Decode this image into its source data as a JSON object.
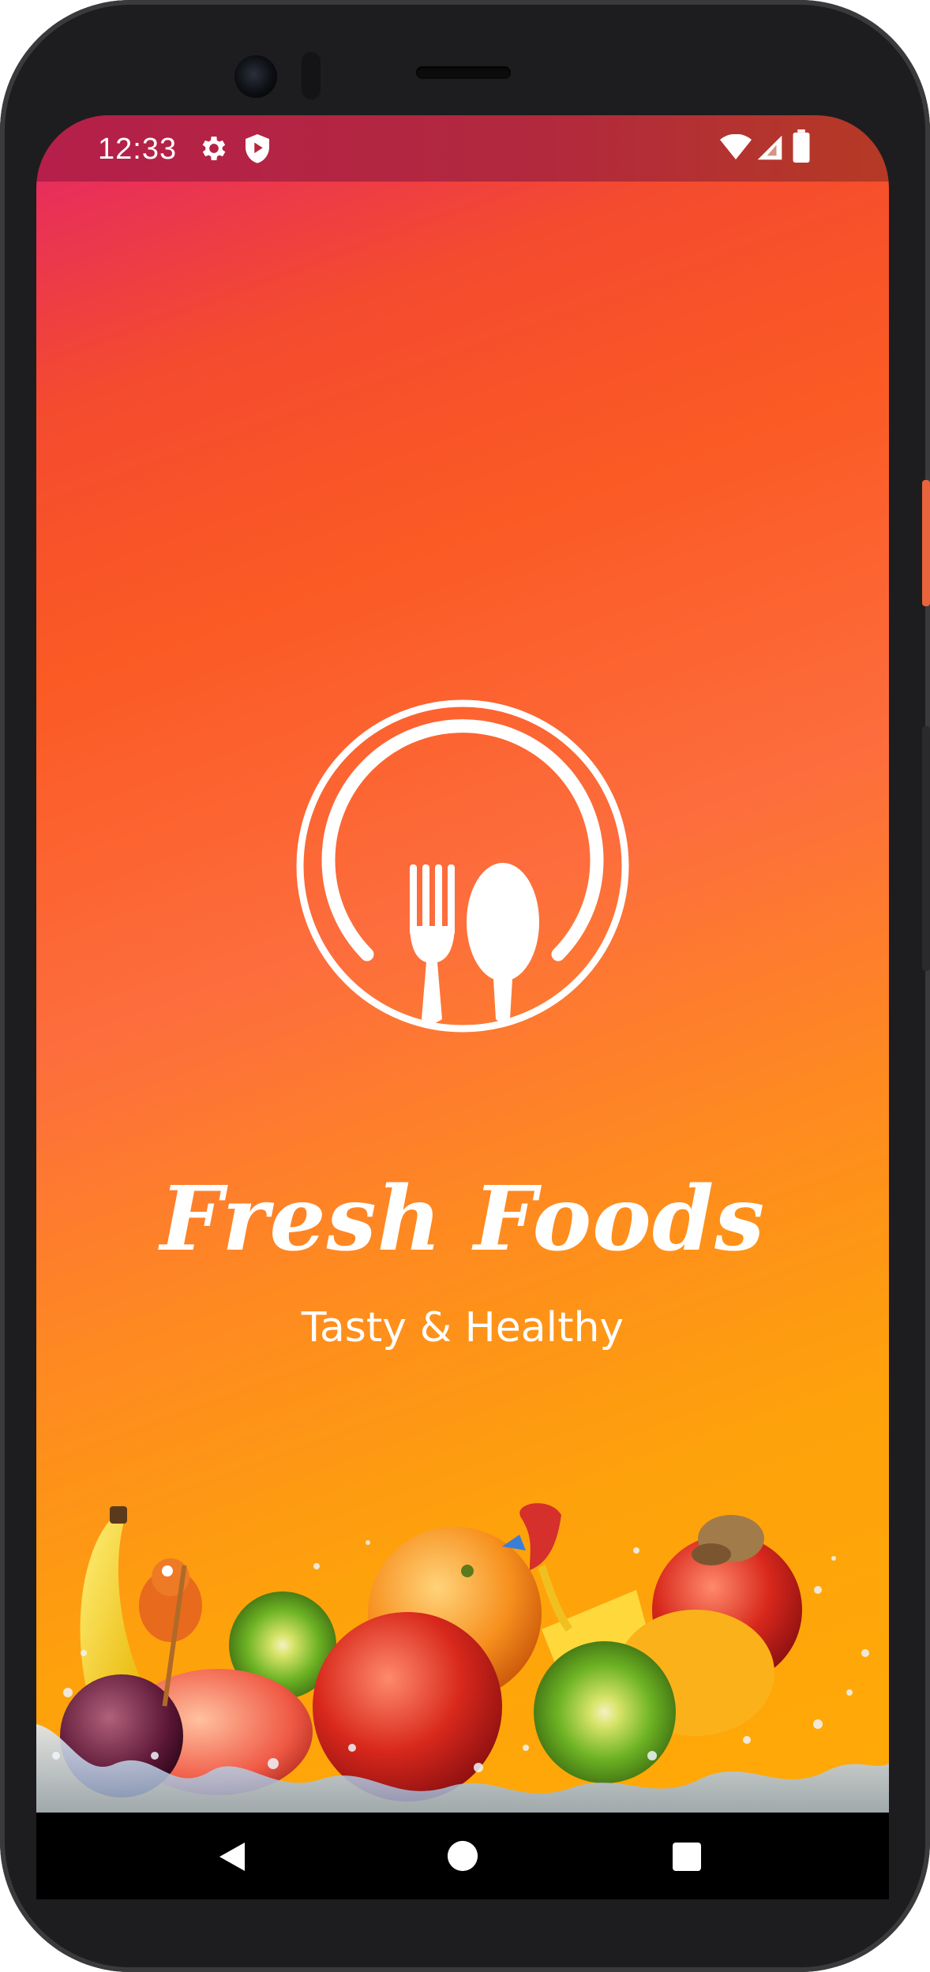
{
  "status_bar": {
    "time": "12:33",
    "left_icons": [
      "gear-icon",
      "shield-play-icon"
    ],
    "right_icons": [
      "wifi-icon",
      "signal-icon",
      "battery-icon"
    ]
  },
  "splash": {
    "title": "Fresh Foods",
    "subtitle": "Tasty & Healthy",
    "logo_icon": "plate-fork-spoon-icon",
    "background_colors": [
      "#e72d5c",
      "#fb5a24",
      "#fe8a20",
      "#ffaa07"
    ]
  },
  "navigation_bar": {
    "buttons": [
      "back-button",
      "home-button",
      "recents-button"
    ]
  }
}
